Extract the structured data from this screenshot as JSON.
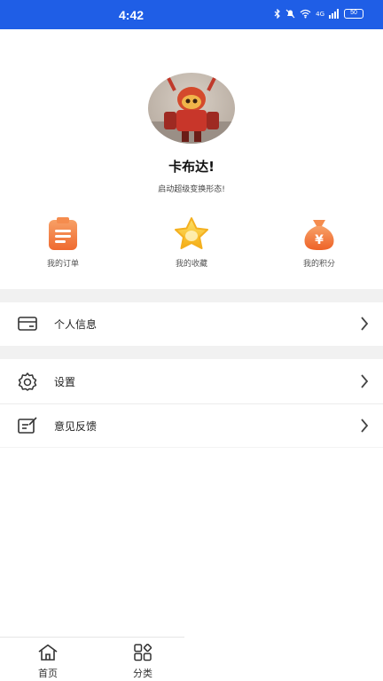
{
  "status_bar": {
    "time": "4:42",
    "network": "4G",
    "battery": "50"
  },
  "profile": {
    "name": "卡布达!",
    "slogan": "启动超级变换形态!"
  },
  "quick_actions": [
    {
      "label": "我的订单",
      "icon": "clipboard-icon",
      "color": "#f2733a"
    },
    {
      "label": "我的收藏",
      "icon": "star-icon",
      "color": "#f7b91c"
    },
    {
      "label": "我的积分",
      "icon": "money-bag-icon",
      "color": "#f2733a"
    }
  ],
  "menu": {
    "personal_info": "个人信息",
    "settings": "设置",
    "feedback": "意见反馈"
  },
  "tabbar": {
    "home": "首页",
    "category": "分类"
  },
  "colors": {
    "status_bar": "#1f5ee6",
    "accent_orange": "#f2733a",
    "accent_yellow": "#f7b91c"
  }
}
